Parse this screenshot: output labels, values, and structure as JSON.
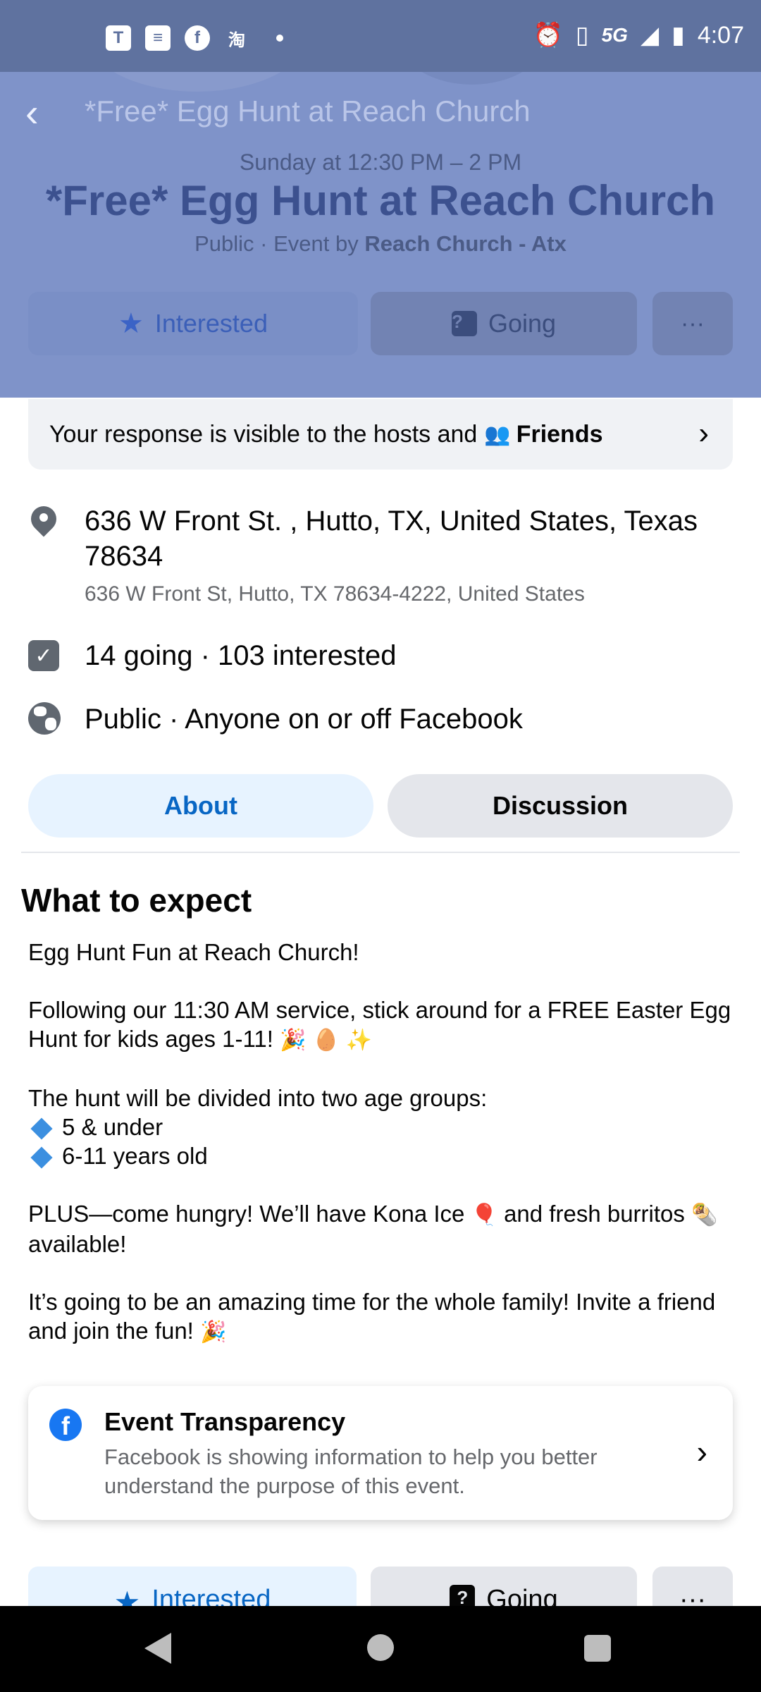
{
  "status_bar": {
    "left_icons": [
      "teams-icon",
      "news-icon",
      "facebook-icon",
      "taobao-icon"
    ],
    "network": "5G",
    "time": "4:07"
  },
  "header": {
    "nav_title": "*Free* Egg Hunt at Reach Church",
    "when": "Sunday at 12:30 PM – 2 PM",
    "title": "*Free* Egg Hunt at Reach Church",
    "sub_prefix": "Public · Event by ",
    "host": "Reach Church - Atx",
    "buttons": {
      "interested": "Interested",
      "going": "Going",
      "more": "···"
    }
  },
  "response_note": {
    "text": "Your response is visible to the hosts and",
    "friends": "Friends"
  },
  "details": {
    "location": "636 W Front St. , Hutto, TX, United States, Texas 78634",
    "location_sub": "636 W Front St, Hutto, TX 78634-4222, United States",
    "attendance": "14 going · 103 interested",
    "privacy": "Public · Anyone on or off Facebook"
  },
  "tabs": {
    "about": "About",
    "discussion": "Discussion"
  },
  "about": {
    "heading": "What to expect",
    "p1": "Egg Hunt Fun at Reach Church!",
    "p2": "Following our 11:30 AM service, stick around for a FREE Easter Egg Hunt for kids ages 1-11!",
    "p2_emoji": "🎉 🥚 ✨",
    "p3": "The hunt will be divided into two age groups:",
    "bullet1": "5 & under",
    "bullet2": "6-11 years old",
    "p4a": "PLUS—come hungry! We’ll have Kona Ice",
    "p4_emoji1": "🎈",
    "p4b": "and fresh burritos",
    "p4_emoji2": "🌯",
    "p4c": "available!",
    "p5": "It’s going to be an amazing time for the whole family! Invite a friend and join the fun!",
    "p5_emoji": "🎉"
  },
  "transparency": {
    "title": "Event Transparency",
    "text": "Facebook is showing information to help you better understand the purpose of this event."
  },
  "bottom_actions": {
    "interested": "Interested",
    "going": "Going",
    "more": "···"
  },
  "colors": {
    "accent": "#0866c4",
    "header_overlay": "#7f93c9",
    "facebook_blue": "#1877f2"
  }
}
